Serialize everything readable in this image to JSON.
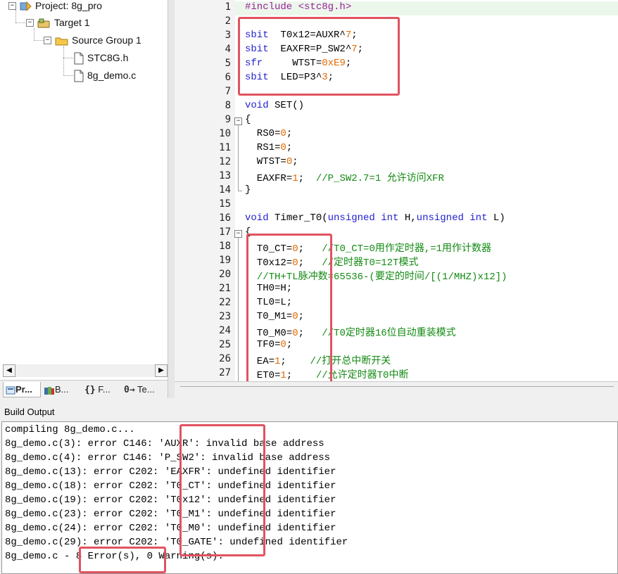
{
  "project_tree": [
    {
      "label": "Project: 8g_pro",
      "icon": "project-icon",
      "level": 0
    },
    {
      "label": "Target 1",
      "icon": "target-icon",
      "level": 1
    },
    {
      "label": "Source Group 1",
      "icon": "folder-icon",
      "level": 2
    },
    {
      "label": "STC8G.h",
      "icon": "file-icon",
      "level": 3
    },
    {
      "label": "8g_demo.c",
      "icon": "file-icon",
      "level": 3
    }
  ],
  "panel_tabs": [
    {
      "label": "Pr...",
      "icon": "project-tab-icon"
    },
    {
      "label": "B...",
      "icon": "books-tab-icon"
    },
    {
      "label": "F...",
      "icon": "functions-tab-icon",
      "glyph": "{}"
    },
    {
      "label": "Te...",
      "icon": "templates-tab-icon",
      "glyph": "0→"
    }
  ],
  "editor": {
    "lines": [
      {
        "n": "1",
        "segs": [
          [
            "#include <stc8g.h>",
            "sfr"
          ]
        ]
      },
      {
        "n": "2",
        "segs": []
      },
      {
        "n": "3",
        "segs": [
          [
            "sbit",
            "kw"
          ],
          [
            "  T0x12=AUXR^",
            ""
          ],
          [
            "7",
            "num"
          ],
          [
            ";",
            ""
          ]
        ]
      },
      {
        "n": "4",
        "segs": [
          [
            "sbit",
            "kw"
          ],
          [
            "  EAXFR=P_SW2^",
            ""
          ],
          [
            "7",
            "num"
          ],
          [
            ";",
            ""
          ]
        ]
      },
      {
        "n": "5",
        "segs": [
          [
            "sfr",
            "kw"
          ],
          [
            "     WTST=",
            ""
          ],
          [
            "0xE9",
            "num"
          ],
          [
            ";",
            ""
          ]
        ]
      },
      {
        "n": "6",
        "segs": [
          [
            "sbit",
            "kw"
          ],
          [
            "  LED=P3^",
            ""
          ],
          [
            "3",
            "num"
          ],
          [
            ";",
            ""
          ]
        ]
      },
      {
        "n": "7",
        "segs": []
      },
      {
        "n": "8",
        "segs": [
          [
            "void",
            "kw"
          ],
          [
            " SET()",
            ""
          ]
        ]
      },
      {
        "n": "9",
        "segs": [
          [
            "{",
            ""
          ]
        ]
      },
      {
        "n": "10",
        "segs": [
          [
            "  RS0=",
            ""
          ],
          [
            "0",
            "num"
          ],
          [
            ";",
            ""
          ]
        ]
      },
      {
        "n": "11",
        "segs": [
          [
            "  RS1=",
            ""
          ],
          [
            "0",
            "num"
          ],
          [
            ";",
            ""
          ]
        ]
      },
      {
        "n": "12",
        "segs": [
          [
            "  WTST=",
            ""
          ],
          [
            "0",
            "num"
          ],
          [
            ";",
            ""
          ]
        ]
      },
      {
        "n": "13",
        "segs": [
          [
            "  EAXFR=",
            ""
          ],
          [
            "1",
            "num"
          ],
          [
            ";  ",
            ""
          ],
          [
            "//P_SW2.7=1 允许访问XFR",
            "cmt"
          ]
        ]
      },
      {
        "n": "14",
        "segs": [
          [
            "}",
            ""
          ]
        ]
      },
      {
        "n": "15",
        "segs": []
      },
      {
        "n": "16",
        "segs": [
          [
            "void",
            "kw"
          ],
          [
            " Timer_T0(",
            ""
          ],
          [
            "unsigned int",
            "kw"
          ],
          [
            " H,",
            ""
          ],
          [
            "unsigned int",
            "kw"
          ],
          [
            " L)",
            ""
          ]
        ]
      },
      {
        "n": "17",
        "segs": [
          [
            "{",
            ""
          ]
        ]
      },
      {
        "n": "18",
        "segs": [
          [
            "  T0_CT=",
            ""
          ],
          [
            "0",
            "num"
          ],
          [
            ";   ",
            ""
          ],
          [
            "//T0_CT=0用作定时器,=1用作计数器",
            "cmt"
          ]
        ]
      },
      {
        "n": "19",
        "segs": [
          [
            "  T0x12=",
            ""
          ],
          [
            "0",
            "num"
          ],
          [
            ";   ",
            ""
          ],
          [
            "//定时器T0=12T模式",
            "cmt"
          ]
        ]
      },
      {
        "n": "20",
        "segs": [
          [
            "  ",
            ""
          ],
          [
            "//TH+TL脉冲数=65536-(要定的时间/[(1/MHZ)x12])",
            "cmt"
          ]
        ]
      },
      {
        "n": "21",
        "segs": [
          [
            "  TH0=H;",
            ""
          ]
        ]
      },
      {
        "n": "22",
        "segs": [
          [
            "  TL0=L;",
            ""
          ]
        ]
      },
      {
        "n": "23",
        "segs": [
          [
            "  T0_M1=",
            ""
          ],
          [
            "0",
            "num"
          ],
          [
            ";",
            ""
          ]
        ]
      },
      {
        "n": "24",
        "segs": [
          [
            "  T0_M0=",
            ""
          ],
          [
            "0",
            "num"
          ],
          [
            ";   ",
            ""
          ],
          [
            "//T0定时器16位自动重装模式",
            "cmt"
          ]
        ]
      },
      {
        "n": "25",
        "segs": [
          [
            "  TF0=",
            ""
          ],
          [
            "0",
            "num"
          ],
          [
            ";",
            ""
          ]
        ]
      },
      {
        "n": "26",
        "segs": [
          [
            "  EA=",
            ""
          ],
          [
            "1",
            "num"
          ],
          [
            ";    ",
            ""
          ],
          [
            "//打开总中断开关",
            "cmt"
          ]
        ]
      },
      {
        "n": "27",
        "segs": [
          [
            "  ET0=",
            ""
          ],
          [
            "1",
            "num"
          ],
          [
            ";    ",
            ""
          ],
          [
            "//允许定时器T0中断",
            "cmt"
          ]
        ]
      }
    ]
  },
  "build_output": {
    "title": "Build Output",
    "lines": [
      "compiling 8g_demo.c...",
      "8g_demo.c(3): error C146: 'AUXR': invalid base address",
      "8g_demo.c(4): error C146: 'P_SW2': invalid base address",
      "8g_demo.c(13): error C202: 'EAXFR': undefined identifier",
      "8g_demo.c(18): error C202: 'T0_CT': undefined identifier",
      "8g_demo.c(19): error C202: 'T0x12': undefined identifier",
      "8g_demo.c(23): error C202: 'T0_M1': undefined identifier",
      "8g_demo.c(24): error C202: 'T0_M0': undefined identifier",
      "8g_demo.c(29): error C202: 'T0_GATE': undefined identifier",
      "8g_demo.c - 8 Error(s), 0 Warning(s)."
    ]
  },
  "colors": {
    "keyword": "#1f1fcf",
    "preprocessor": "#9a1f9a",
    "number": "#e06a00",
    "comment": "#138a13",
    "annotation_box": "#e05360"
  }
}
